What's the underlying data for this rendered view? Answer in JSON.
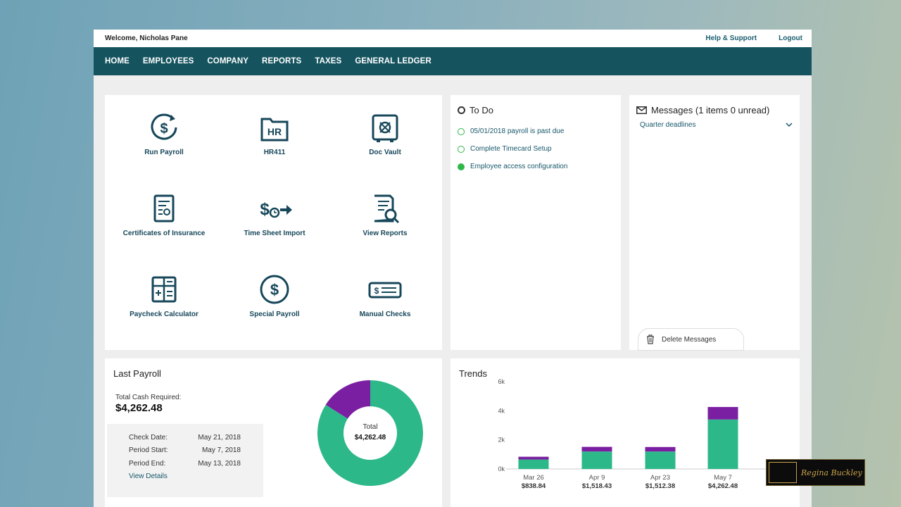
{
  "topbar": {
    "welcome": "Welcome, Nicholas Pane",
    "help": "Help & Support",
    "logout": "Logout"
  },
  "nav": [
    "HOME",
    "EMPLOYEES",
    "COMPANY",
    "REPORTS",
    "TAXES",
    "GENERAL LEDGER"
  ],
  "quick_actions": [
    {
      "label": "Run Payroll",
      "icon": "run-payroll-icon"
    },
    {
      "label": "HR411",
      "icon": "hr-folder-icon"
    },
    {
      "label": "Doc Vault",
      "icon": "vault-icon"
    },
    {
      "label": "Certificates of Insurance",
      "icon": "certificate-icon"
    },
    {
      "label": "Time Sheet Import",
      "icon": "time-import-icon"
    },
    {
      "label": "View Reports",
      "icon": "report-search-icon"
    },
    {
      "label": "Paycheck Calculator",
      "icon": "calculator-icon"
    },
    {
      "label": "Special Payroll",
      "icon": "dollar-circle-icon"
    },
    {
      "label": "Manual Checks",
      "icon": "check-icon"
    }
  ],
  "todo": {
    "title": "To Do",
    "items": [
      {
        "text": "05/01/2018 payroll is past due",
        "done": false
      },
      {
        "text": "Complete Timecard Setup",
        "done": false
      },
      {
        "text": "Employee access configuration",
        "done": true
      }
    ]
  },
  "messages": {
    "title": "Messages (1 items 0 unread)",
    "items": [
      "Quarter deadlines"
    ],
    "delete_label": "Delete Messages"
  },
  "last_payroll": {
    "title": "Last Payroll",
    "total_label": "Total Cash Required:",
    "total_value": "$4,262.48",
    "check_date_label": "Check Date:",
    "check_date": "May 21, 2018",
    "period_start_label": "Period Start:",
    "period_start": "May 7, 2018",
    "period_end_label": "Period End:",
    "period_end": "May 13, 2018",
    "view_details": "View Details",
    "donut_label": "Total",
    "donut_value": "$4,262.48"
  },
  "trends": {
    "title": "Trends"
  },
  "chart_data": [
    {
      "type": "pie",
      "title": "",
      "center_label": "Total",
      "center_value": "$4,262.48",
      "values": [
        0.84,
        0.16
      ],
      "colors": [
        "#2db88a",
        "#7b1fa2"
      ]
    },
    {
      "type": "bar",
      "title": "Trends",
      "categories": [
        "Mar 26",
        "Apr 9",
        "Apr 23",
        "May 7"
      ],
      "category_totals": [
        "$838.84",
        "$1,518.43",
        "$1,512.38",
        "$4,262.48"
      ],
      "series": [
        {
          "values": [
            650,
            1200,
            1200,
            3400
          ],
          "color": "#2db88a"
        },
        {
          "values": [
            190,
            320,
            310,
            860
          ],
          "color": "#7b1fa2"
        }
      ],
      "yticks": [
        "0k",
        "2k",
        "4k",
        "6k"
      ],
      "ylim": [
        0,
        6000
      ],
      "grid": false
    }
  ],
  "watermark": {
    "text": "Regina Buckley"
  }
}
